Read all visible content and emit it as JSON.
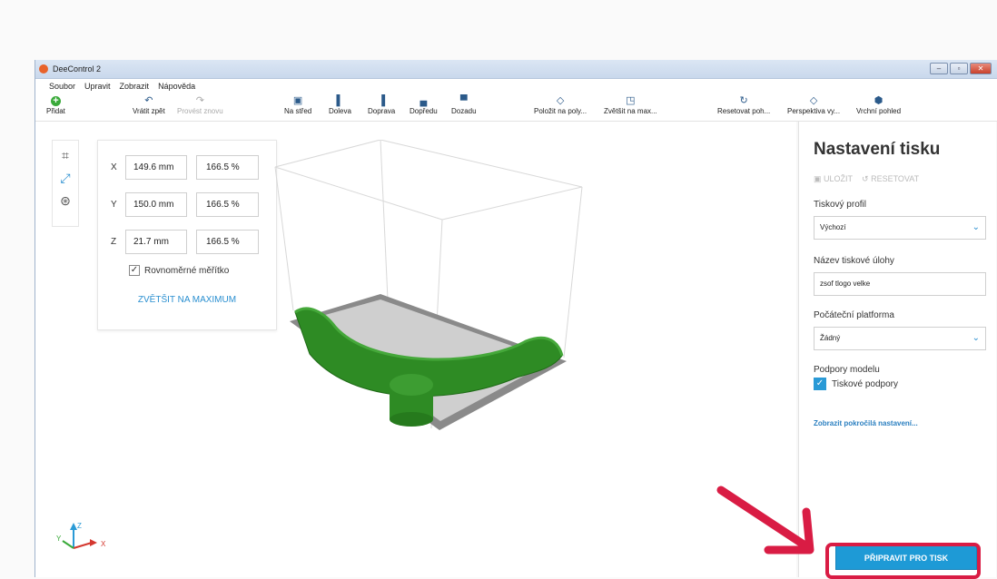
{
  "window": {
    "title": "DeeControl 2",
    "controls": [
      "‒",
      "▫",
      "✕"
    ]
  },
  "menu": [
    "Soubor",
    "Upravit",
    "Zobrazit",
    "Nápověda"
  ],
  "toolbar": {
    "add": "Přidat",
    "undo": "Vrátit zpět",
    "redo": "Provést znovu",
    "center": "Na střed",
    "left": "Doleva",
    "right": "Doprava",
    "front": "Dopředu",
    "back": "Dozadu",
    "lay_flat": "Položit na poly...",
    "scale_max": "Zvětšit na max...",
    "reset_view": "Resetovat poh...",
    "perspective": "Perspektiva vy...",
    "top_view": "Vrchní pohled"
  },
  "scale_panel": {
    "x": {
      "axis": "X",
      "mm": "149.6 mm",
      "pct": "166.5 %"
    },
    "y": {
      "axis": "Y",
      "mm": "150.0 mm",
      "pct": "166.5 %"
    },
    "z": {
      "axis": "Z",
      "mm": "21.7 mm",
      "pct": "166.5 %"
    },
    "uniform_label": "Rovnoměrné měřítko",
    "uniform_checked": true,
    "maximize_link": "ZVĚTŠIT NA MAXIMUM"
  },
  "axes": {
    "x": "X",
    "y": "Y",
    "z": "Z"
  },
  "print_settings": {
    "title": "Nastavení tisku",
    "save": "ULOŽIT",
    "reset": "RESETOVAT",
    "profile_label": "Tiskový profil",
    "profile_value": "Výchozí",
    "job_name_label": "Název tiskové úlohy",
    "job_name_value": "zsof tlogo velke",
    "platform_label": "Počáteční platforma",
    "platform_value": "Žádný",
    "supports_label": "Podpory modelu",
    "supports_check": "Tiskové podpory",
    "advanced_link": "Zobrazit pokročilá nastavení...",
    "prepare_button": "PŘIPRAVIT PRO TISK"
  },
  "colors": {
    "accent": "#1e9ad6",
    "model": "#2e8b24",
    "highlight": "#d91c44"
  }
}
